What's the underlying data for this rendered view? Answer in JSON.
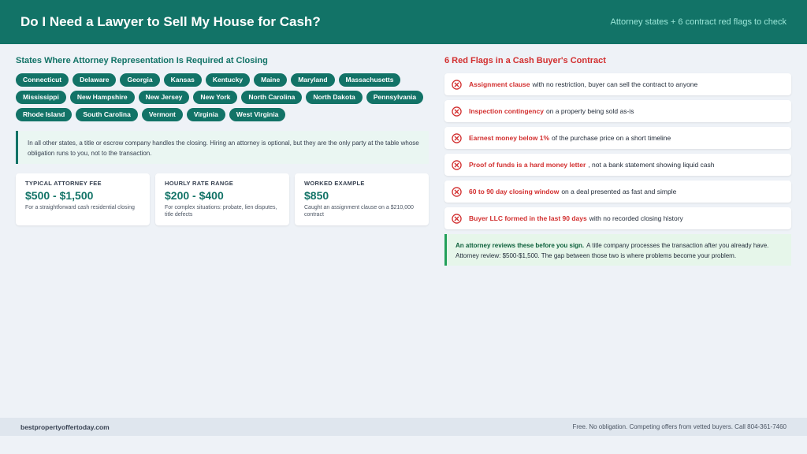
{
  "header": {
    "title": "Do I Need a Lawyer to Sell My House for Cash?",
    "subtitle": "Attorney states + 6 contract red flags to check"
  },
  "states_section": {
    "title": "States Where Attorney Representation Is Required at Closing",
    "states": [
      "Connecticut",
      "Delaware",
      "Georgia",
      "Kansas",
      "Kentucky",
      "Maine",
      "Maryland",
      "Massachusetts",
      "Mississippi",
      "New Hampshire",
      "New Jersey",
      "New York",
      "North Carolina",
      "North Dakota",
      "Pennsylvania",
      "Rhode Island",
      "South Carolina",
      "Vermont",
      "Virginia",
      "West Virginia"
    ],
    "notice": "In all other states, a title or escrow company handles the closing. Hiring an attorney is optional, but they are the only party at the table whose obligation runs to you, not to the transaction."
  },
  "cards": [
    {
      "label": "TYPICAL ATTORNEY FEE",
      "value": "$500 - $1,500",
      "note": "For a straightforward cash residential closing"
    },
    {
      "label": "HOURLY RATE RANGE",
      "value": "$200 - $400",
      "note": "For complex situations: probate, lien disputes, title defects"
    },
    {
      "label": "WORKED EXAMPLE",
      "value": "$850",
      "note": "Caught an assignment clause on a $210,000 contract"
    }
  ],
  "flags_section": {
    "title": "6 Red Flags in a Cash Buyer's Contract",
    "flags": [
      {
        "strong": "Assignment clause",
        "rest": "with no restriction, buyer can sell the contract to anyone"
      },
      {
        "strong": "Inspection contingency",
        "rest": "on a property being sold as-is"
      },
      {
        "strong": "Earnest money below 1%",
        "rest": "of the purchase price on a short timeline"
      },
      {
        "strong": "Proof of funds is a hard money letter",
        "rest": ", not a bank statement showing liquid cash"
      },
      {
        "strong": "60 to 90 day closing window",
        "rest": "on a deal presented as fast and simple"
      },
      {
        "strong": "Buyer LLC formed in the last 90 days",
        "rest": "with no recorded closing history"
      }
    ],
    "callout_strong": "An attorney reviews these before you sign.",
    "callout_rest": "A title company processes the transaction after you already have. Attorney review: $500-$1,500. The gap between those two is where problems become your problem."
  },
  "footer": {
    "site": "bestpropertyoffertoday.com",
    "note": "Free. No obligation. Competing offers from vetted buyers. Call 804-361-7460"
  },
  "colors": {
    "brand": "#127367",
    "alert": "#d22f2f",
    "success": "#22a05a"
  },
  "icons": {
    "flag": "x-circle-icon"
  }
}
